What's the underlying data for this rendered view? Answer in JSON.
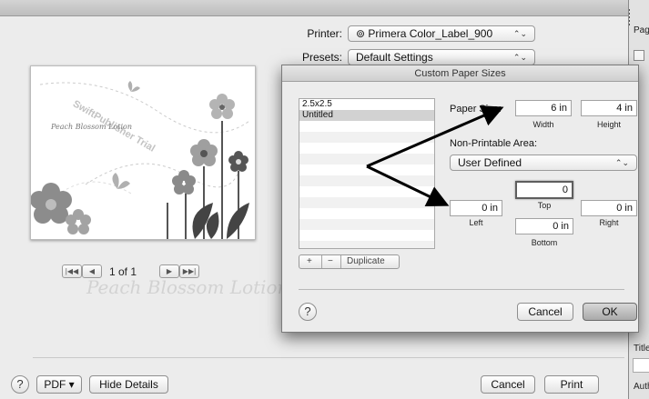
{
  "printer": {
    "label": "Printer:",
    "value": "Primera Color_Label_900",
    "printer_icon": "printer-status-icon"
  },
  "presets": {
    "label": "Presets:",
    "value": "Default Settings"
  },
  "preview": {
    "card_text": "Peach Blossom Lotion",
    "watermark_text": "SwiftPublisher Trial",
    "ghost_text": "Peach Blossom Lotion"
  },
  "pager": {
    "first": "|◀◀",
    "prev": "◀",
    "text": "1 of 1",
    "next": "▶",
    "last": "▶▶|"
  },
  "bottom": {
    "help": "?",
    "pdf_label": "PDF ▾",
    "hide_details": "Hide Details",
    "cancel": "Cancel",
    "print": "Print"
  },
  "right_panel": {
    "label_top": "Page",
    "label_title": "Title",
    "label_author": "Auth"
  },
  "sheet": {
    "title": "Custom Paper Sizes",
    "sizes": [
      "2.5x2.5",
      "Untitled"
    ],
    "selected_index": 1,
    "add": "+",
    "remove": "−",
    "duplicate": "Duplicate",
    "paper_size_label": "Paper Size:",
    "width_value": "6 in",
    "height_value": "4 in",
    "width_label": "Width",
    "height_label": "Height",
    "non_printable_label": "Non-Printable Area:",
    "non_printable_value": "User Defined",
    "top_value": "0",
    "left_value": "0 in",
    "right_value": "0 in",
    "bottom_value": "0 in",
    "top_label": "Top",
    "left_label": "Left",
    "right_label": "Right",
    "bottom_label": "Bottom",
    "help": "?",
    "cancel": "Cancel",
    "ok": "OK"
  },
  "colors": {
    "annotation_arrow": "#000000",
    "default_button": "#b9b9b9"
  }
}
